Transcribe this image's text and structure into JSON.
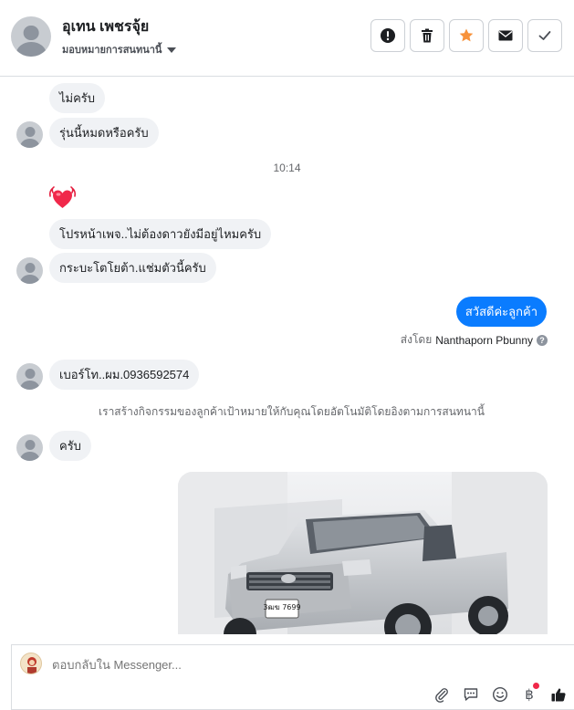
{
  "header": {
    "contact_name": "อุเทน เพชรจุ้ย",
    "assign_label": "มอบหมายการสนทนานี้",
    "actions": [
      "spam-icon",
      "trash-icon",
      "star-icon",
      "mail-icon",
      "check-icon"
    ]
  },
  "thread": {
    "messages": [
      {
        "side": "in",
        "text": "ไม่ครับ"
      },
      {
        "side": "in",
        "text": "รุ่นนี้หมดหรือครับ"
      },
      {
        "type": "time",
        "text": "10:14"
      },
      {
        "side": "in",
        "type": "sticker",
        "icon": "heart-icon"
      },
      {
        "side": "in",
        "text": "โปรหน้าเพจ..ไม่ต้องดาวยังมีอยู่ไหมครับ"
      },
      {
        "side": "in",
        "text": "กระบะโตโยต้า.แช่มตัวนี้ครับ"
      },
      {
        "side": "out",
        "text": "สวัสดีค่ะลูกค้า"
      },
      {
        "type": "sent_by",
        "prefix": "ส่งโดย",
        "name": "Nanthaporn Pbunny"
      },
      {
        "side": "in",
        "text": "เบอร์โท..ผม.0936592574"
      },
      {
        "type": "system",
        "text": "เราสร้างกิจกรรมของลูกค้าเป้าหมายให้กับคุณโดยอัตโนมัติโดยอิงตามการสนทนานี้"
      },
      {
        "side": "in",
        "text": "ครับ"
      },
      {
        "side": "out",
        "type": "photo",
        "plate": "3ฒฆ 7699"
      }
    ]
  },
  "composer": {
    "placeholder": "ตอบกลับใน Messenger...",
    "tools": [
      "attach-icon",
      "saved-reply-icon",
      "emoji-icon",
      "baht-icon",
      "like-icon"
    ],
    "baht_symbol": "฿"
  },
  "colors": {
    "accent": "#0a7cff",
    "star": "#f7923b",
    "bubble_in": "#f0f2f5"
  }
}
